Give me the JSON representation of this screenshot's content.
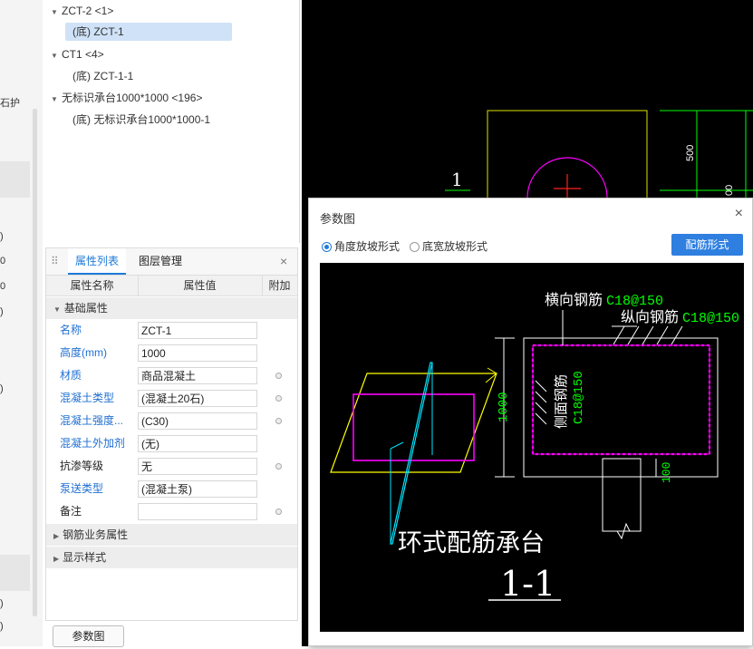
{
  "left_strip": {
    "labels": [
      "石护",
      ")",
      "0",
      "0",
      ")",
      ")",
      ")",
      ")",
      ")"
    ]
  },
  "tree": {
    "items": [
      {
        "label": "ZCT-2 <1>",
        "level": 0,
        "expanded": true
      },
      {
        "label": "(底) ZCT-1",
        "level": 1,
        "selected": true
      },
      {
        "label": "CT1 <4>",
        "level": 0,
        "expanded": true
      },
      {
        "label": "(底) ZCT-1-1",
        "level": 1
      },
      {
        "label": "无标识承台1000*1000 <196>",
        "level": 0,
        "expanded": true
      },
      {
        "label": "(底) 无标识承台1000*1000-1",
        "level": 1
      }
    ]
  },
  "props": {
    "tabs": {
      "list": "属性列表",
      "layers": "图层管理",
      "close": "×"
    },
    "columns": {
      "name": "属性名称",
      "value": "属性值",
      "extra": "附加"
    },
    "group_basic": "基础属性",
    "rows": [
      {
        "name": "名称",
        "value": "ZCT-1",
        "link": true,
        "dot": false
      },
      {
        "name": "高度(mm)",
        "value": "1000",
        "link": true,
        "dot": false
      },
      {
        "name": "材质",
        "value": "商品混凝土",
        "link": true,
        "dot": true
      },
      {
        "name": "混凝土类型",
        "value": "(混凝土20石)",
        "link": true,
        "dot": true
      },
      {
        "name": "混凝土强度...",
        "value": "(C30)",
        "link": true,
        "dot": true
      },
      {
        "name": "混凝土外加剂",
        "value": "(无)",
        "link": true,
        "dot": false
      },
      {
        "name": "抗渗等级",
        "value": "无",
        "link": false,
        "dot": true
      },
      {
        "name": "泵送类型",
        "value": "(混凝土泵)",
        "link": true,
        "dot": false
      },
      {
        "name": "备注",
        "value": "",
        "link": false,
        "dot": true
      }
    ],
    "group_rebar": "钢筋业务属性",
    "group_display": "显示样式"
  },
  "param_button": "参数图",
  "cad_bg": {
    "label_1": "1",
    "dim_500": "500",
    "dim_00": "00"
  },
  "dialog": {
    "title": "参数图",
    "close": "×",
    "radio_angle": "角度放坡形式",
    "radio_width": "底宽放坡形式",
    "config_button": "配筋形式",
    "diagram": {
      "lbl_horizontal": "横向钢筋",
      "val_horizontal": "C18@150",
      "lbl_longitudinal": "纵向钢筋",
      "val_longitudinal": "C18@150",
      "lbl_side": "侧面钢筋",
      "val_side": "C18@150",
      "dim_height": "1000",
      "dim_cover": "100",
      "main_title": "环式配筋承台",
      "section": "1-1"
    }
  },
  "colors": {
    "accent": "#1f7ad8",
    "cad_green": "#00ff00",
    "cad_magenta": "#ff00ff",
    "cad_yellow": "#ffff00",
    "cad_cyan": "#00ffff"
  }
}
